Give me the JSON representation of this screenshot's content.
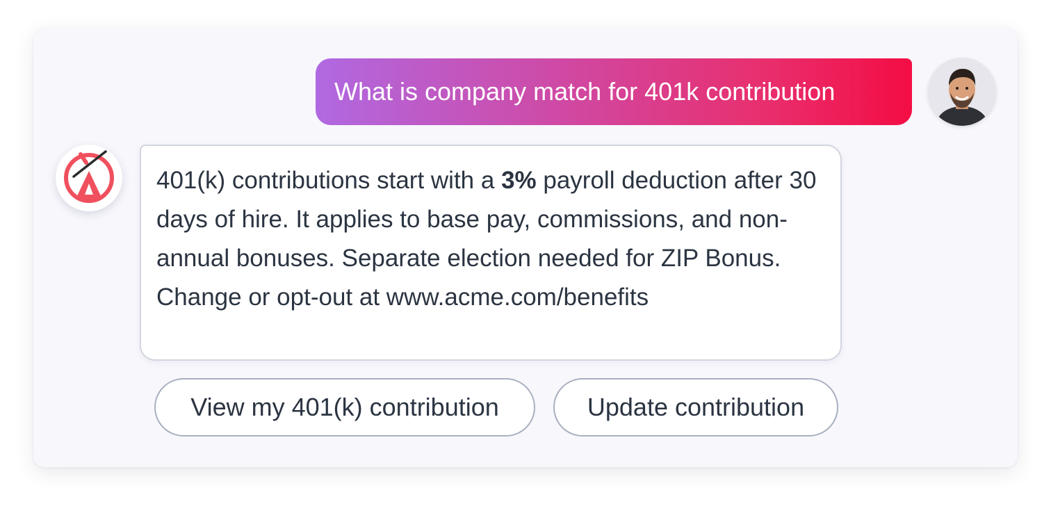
{
  "conversation": {
    "user_message": "What is company match for 401k contribution",
    "bot_message": {
      "text_before": "401(k) contributions start with a ",
      "highlight": "3%",
      "text_after": " payroll deduction after 30 days of hire. It applies to base pay, commissions, and non-annual bonuses. Separate election needed for ZIP Bonus. Change or opt-out at www.acme.com/benefits"
    },
    "quick_replies": [
      {
        "label": "View my 401(k) contribution"
      },
      {
        "label": "Update contribution"
      }
    ]
  },
  "colors": {
    "gradient_start": "#b069e2",
    "gradient_end": "#f40d44",
    "bot_logo": "#f0505e",
    "text": "#2b3441"
  },
  "icons": {
    "user_avatar": "user-avatar-photo",
    "bot_avatar": "bot-logo-icon"
  }
}
